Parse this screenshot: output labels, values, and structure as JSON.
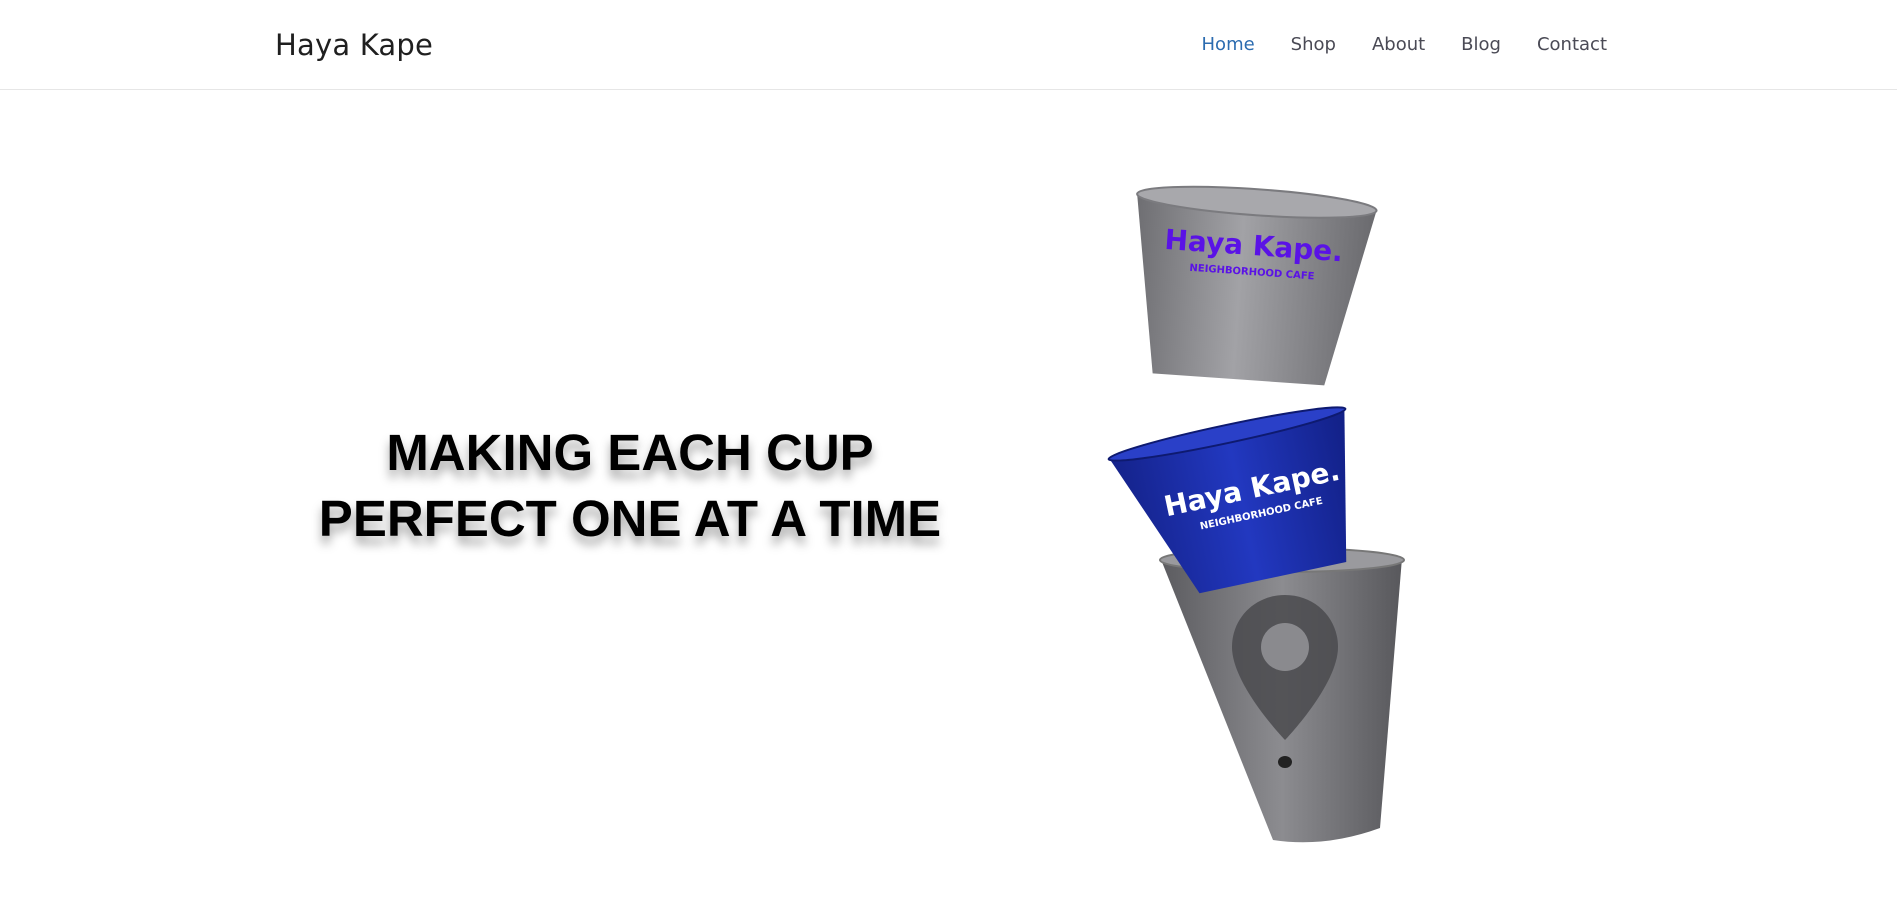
{
  "nav": {
    "brand": "Haya Kape",
    "links": [
      {
        "label": "Home",
        "active": true
      },
      {
        "label": "Shop"
      },
      {
        "label": "About"
      },
      {
        "label": "Blog"
      },
      {
        "label": "Contact"
      }
    ],
    "active_color": "#2c6cb0"
  },
  "hero": {
    "line1": "MAKING EACH CUP",
    "line2": "PERFECT ONE AT A TIME"
  },
  "cups": {
    "top": {
      "brand": "Haya Kape.",
      "tag": "NEIGHBORHOOD CAFE",
      "color": "#8e8e92",
      "text_color": "#5a12e6"
    },
    "middle": {
      "brand": "Haya Kape.",
      "tag": "NEIGHBORHOOD CAFE",
      "color": "#1a2fb0",
      "text_color": "#ffffff"
    },
    "bottom": {
      "color": "#7a7a7e",
      "icon": "location-pin-icon"
    }
  }
}
